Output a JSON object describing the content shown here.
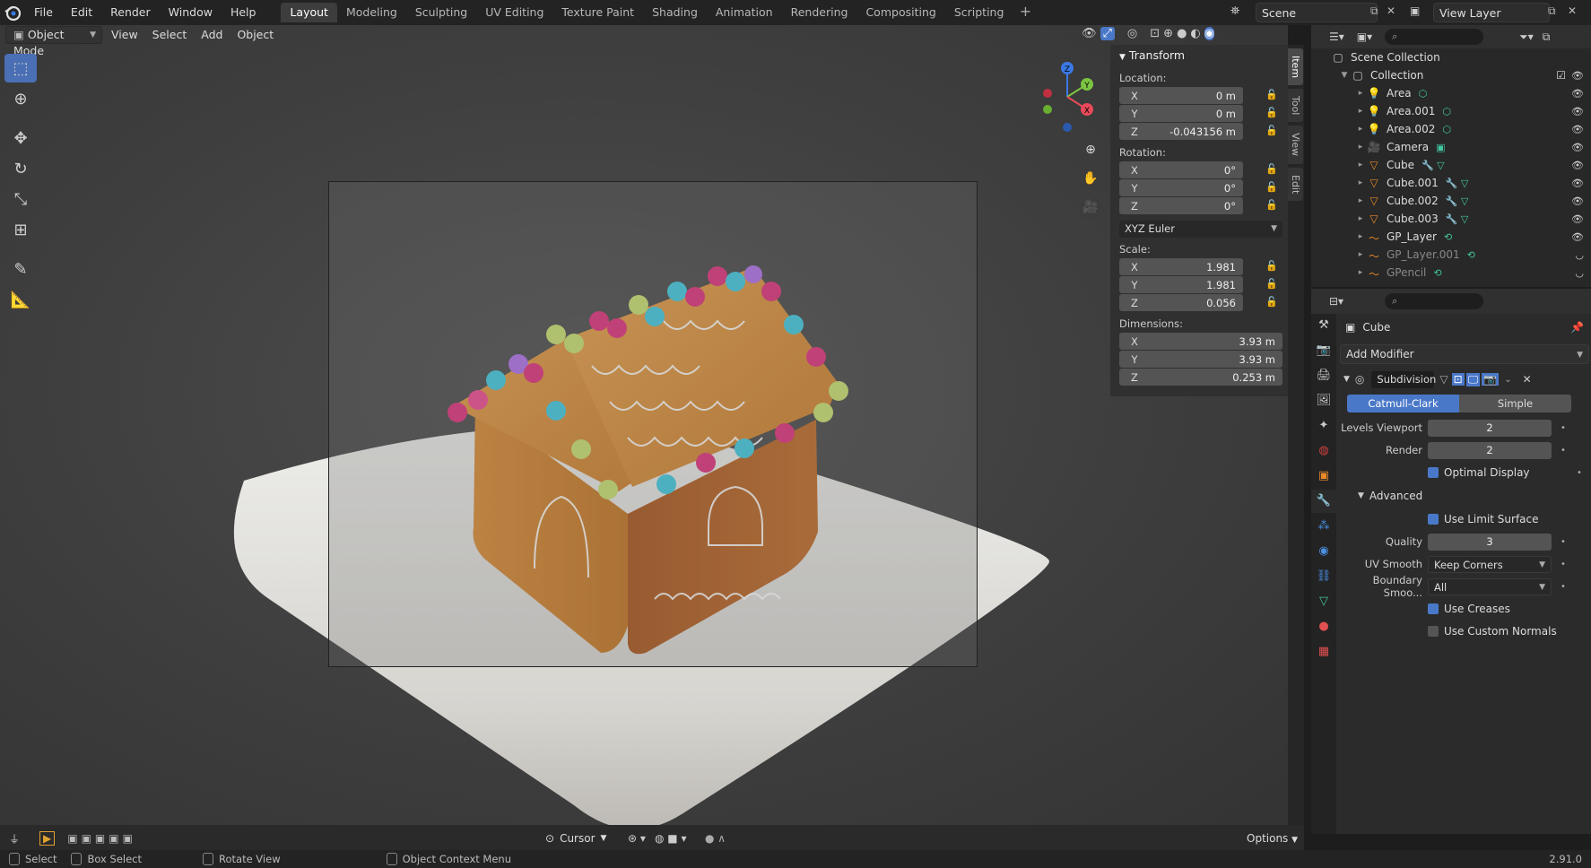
{
  "menubar": {
    "items": [
      "File",
      "Edit",
      "Render",
      "Window",
      "Help"
    ],
    "workspaces": [
      "Layout",
      "Modeling",
      "Sculpting",
      "UV Editing",
      "Texture Paint",
      "Shading",
      "Animation",
      "Rendering",
      "Compositing",
      "Scripting"
    ],
    "active_workspace": "Layout",
    "scene": "Scene",
    "view_layer": "View Layer"
  },
  "viewport_header": {
    "mode": "Object Mode",
    "menus": [
      "View",
      "Select",
      "Add",
      "Object"
    ]
  },
  "toolbar": {
    "tools": [
      "select-box-icon",
      "cursor-icon",
      "move-icon",
      "rotate-icon",
      "scale-icon",
      "transform-icon",
      "annotate-icon",
      "measure-icon"
    ]
  },
  "gizmo": {
    "z": "Z",
    "y": "Y",
    "x": "X"
  },
  "npanel": {
    "title": "Transform",
    "location_label": "Location:",
    "location": [
      {
        "axis": "X",
        "value": "0 m"
      },
      {
        "axis": "Y",
        "value": "0 m"
      },
      {
        "axis": "Z",
        "value": "-0.043156 m"
      }
    ],
    "rotation_label": "Rotation:",
    "rotation": [
      {
        "axis": "X",
        "value": "0°"
      },
      {
        "axis": "Y",
        "value": "0°"
      },
      {
        "axis": "Z",
        "value": "0°"
      }
    ],
    "rotation_mode": "XYZ Euler",
    "scale_label": "Scale:",
    "scale": [
      {
        "axis": "X",
        "value": "1.981"
      },
      {
        "axis": "Y",
        "value": "1.981"
      },
      {
        "axis": "Z",
        "value": "0.056"
      }
    ],
    "dimensions_label": "Dimensions:",
    "dimensions": [
      {
        "axis": "X",
        "value": "3.93 m"
      },
      {
        "axis": "Y",
        "value": "3.93 m"
      },
      {
        "axis": "Z",
        "value": "0.253 m"
      }
    ],
    "tabs": [
      "Item",
      "Tool",
      "View",
      "Edit"
    ]
  },
  "bottombar": {
    "pivot": "Cursor",
    "options": "Options"
  },
  "statusbar": {
    "items": [
      "Select",
      "Box Select",
      "Rotate View",
      "Object Context Menu"
    ],
    "version": "2.91.0"
  },
  "outliner": {
    "root": "Scene Collection",
    "collection": "Collection",
    "items": [
      {
        "name": "Area",
        "icon": "light-icon",
        "dim": false
      },
      {
        "name": "Area.001",
        "icon": "light-icon",
        "dim": false
      },
      {
        "name": "Area.002",
        "icon": "light-icon",
        "dim": false
      },
      {
        "name": "Camera",
        "icon": "camera-icon",
        "dim": false
      },
      {
        "name": "Cube",
        "icon": "mesh-icon",
        "dim": false
      },
      {
        "name": "Cube.001",
        "icon": "mesh-icon",
        "dim": false
      },
      {
        "name": "Cube.002",
        "icon": "mesh-icon",
        "dim": false
      },
      {
        "name": "Cube.003",
        "icon": "mesh-icon",
        "dim": false
      },
      {
        "name": "GP_Layer",
        "icon": "grease-pencil-icon",
        "dim": false
      },
      {
        "name": "GP_Layer.001",
        "icon": "grease-pencil-icon",
        "dim": true
      },
      {
        "name": "GPencil",
        "icon": "grease-pencil-icon",
        "dim": true
      }
    ]
  },
  "properties": {
    "object_name": "Cube",
    "add_modifier": "Add Modifier",
    "modifier_name": "Subdivision",
    "mode_catmull": "Catmull-Clark",
    "mode_simple": "Simple",
    "levels_viewport_label": "Levels Viewport",
    "levels_viewport": "2",
    "render_label": "Render",
    "render": "2",
    "optimal_display": "Optimal Display",
    "advanced": "Advanced",
    "use_limit_surface": "Use Limit Surface",
    "quality_label": "Quality",
    "quality": "3",
    "uv_smooth_label": "UV Smooth",
    "uv_smooth": "Keep Corners",
    "boundary_label": "Boundary Smoo...",
    "boundary": "All",
    "use_creases": "Use Creases",
    "use_custom_normals": "Use Custom Normals"
  },
  "colors": {
    "accent": "#4a78c8",
    "active_tool": "#4a6fb5",
    "axis_x": "#e84a5a",
    "axis_y": "#7bc442",
    "axis_z": "#3a78e6"
  }
}
